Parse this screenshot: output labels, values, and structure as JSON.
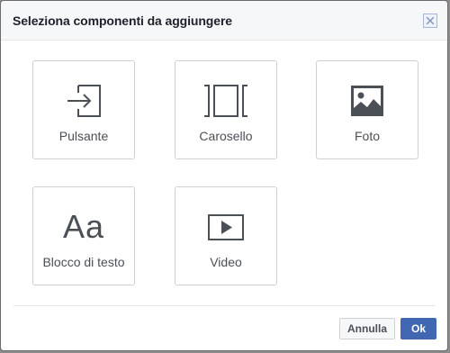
{
  "dialog": {
    "title": "Seleziona componenti da aggiungere",
    "close_icon": "close-icon"
  },
  "components": [
    {
      "label": "Pulsante",
      "icon": "button-arrow-icon"
    },
    {
      "label": "Carosello",
      "icon": "carousel-icon"
    },
    {
      "label": "Foto",
      "icon": "photo-icon"
    },
    {
      "label": "Blocco di testo",
      "icon": "text-block-icon",
      "icon_text": "Aa"
    },
    {
      "label": "Video",
      "icon": "video-play-icon"
    }
  ],
  "footer": {
    "cancel_label": "Annulla",
    "ok_label": "Ok"
  },
  "colors": {
    "primary": "#4267b2",
    "icon": "#4b4f56",
    "tile_border": "#cdd0d5"
  }
}
